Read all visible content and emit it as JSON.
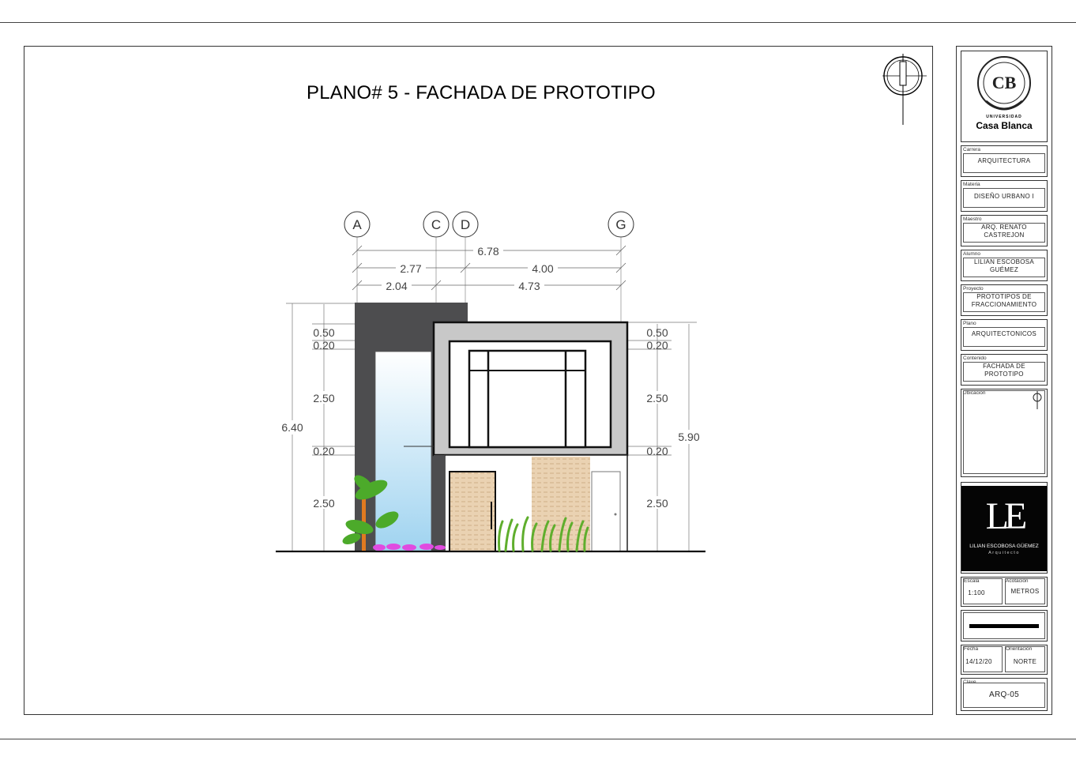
{
  "title": "PLANO# 5 - FACHADA DE PROTOTIPO",
  "axes": [
    "A",
    "C",
    "D",
    "G"
  ],
  "dims_horizontal": [
    "6.78",
    "2.77",
    "4.00",
    "2.04",
    "4.73"
  ],
  "dims_left": [
    "0.50",
    "0.20",
    "2.50",
    "0.20",
    "2.50"
  ],
  "dims_right": [
    "0.50",
    "0.20",
    "2.50",
    "0.20",
    "2.50"
  ],
  "dim_total_left": "6.40",
  "dim_total_right": "5.90",
  "logo": {
    "top_text": "UNIVERSIDAD",
    "name": "Casa Blanca"
  },
  "title_block": {
    "carrera": {
      "caption": "Carrera",
      "value": "ARQUITECTURA"
    },
    "materia": {
      "caption": "Materia",
      "value": "DISEÑO URBANO I"
    },
    "maestro": {
      "caption": "Maestro",
      "value_1": "ARQ. RENATO",
      "value_2": "CASTREJON"
    },
    "alumno": {
      "caption": "Alumno",
      "value_1": "LILIAN ESCOBOSA",
      "value_2": "GUÉMEZ"
    },
    "proyecto": {
      "caption": "Proyecto",
      "value_1": "PROTOTIPOS DE",
      "value_2": "FRACCIONAMIENTO"
    },
    "plano": {
      "caption": "Plano",
      "value": "ARQUITECTONICOS"
    },
    "contenido": {
      "caption": "Contenido",
      "value_1": "FACHADA DE",
      "value_2": "PROTOTIPO"
    },
    "ubicacion": {
      "caption": "Ubicación"
    },
    "escala": {
      "caption": "Escala",
      "value": "1:100"
    },
    "acotacion": {
      "caption": "Acotación",
      "value": "METROS"
    },
    "fecha": {
      "caption": "Fecha",
      "value": "14/12/20"
    },
    "orientacion": {
      "caption": "Orientación",
      "value": "NORTE"
    },
    "clave": {
      "caption": "Clave",
      "value": "ARQ-05"
    }
  },
  "brand": {
    "initials": "LE",
    "name": "LILIAN ESCOBOSA GÜEMEZ",
    "role": "Arquitecto"
  },
  "colors": {
    "wall_dark": "#4d4d4f",
    "frame_gray": "#c8c8c8",
    "glass": "#b9dff5",
    "wood": "#ead2b2",
    "plant_green": "#5fae2d",
    "flower_pink": "#e04be0"
  }
}
